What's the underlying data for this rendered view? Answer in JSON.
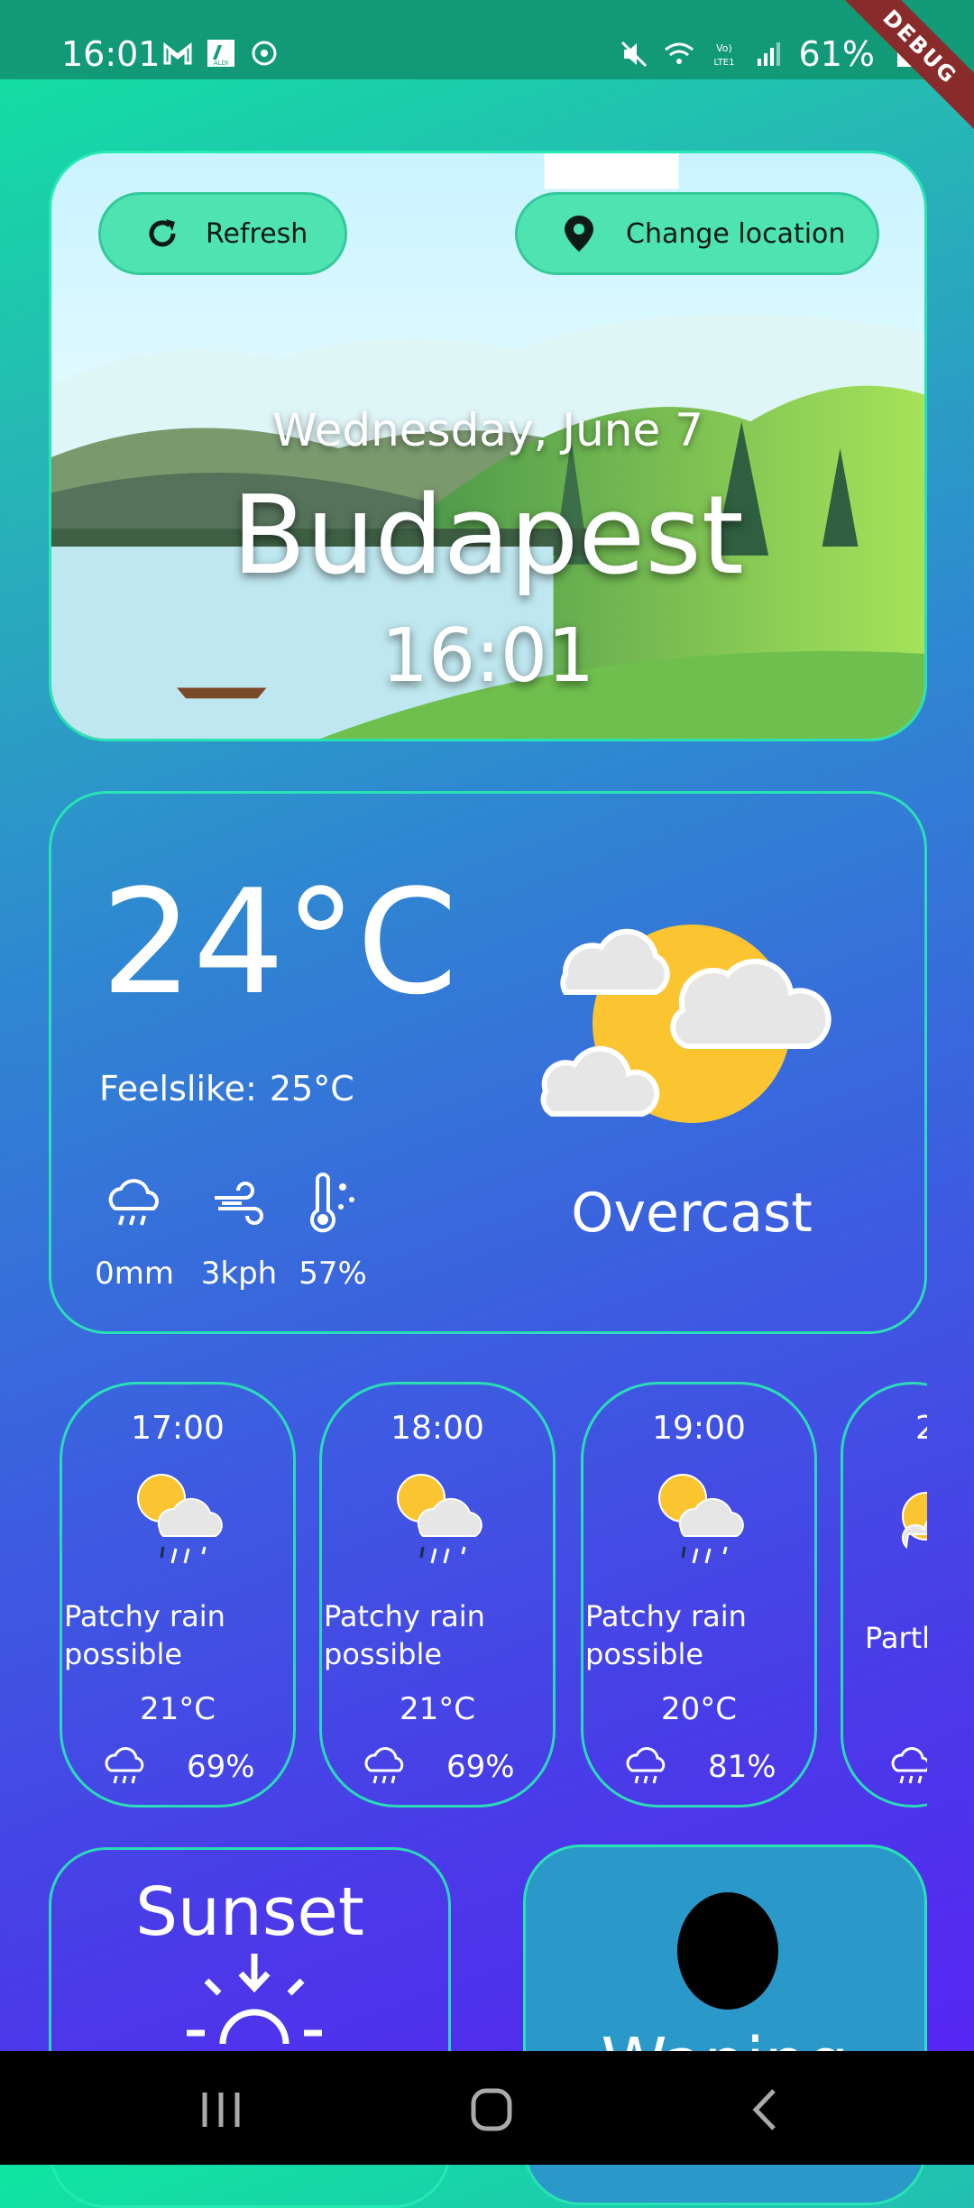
{
  "status_bar": {
    "time": "16:01",
    "battery": "61%",
    "left_icons": [
      "gmail-icon",
      "aldi-icon",
      "sync-icon"
    ],
    "right_icons": [
      "mute-icon",
      "wifi-icon",
      "volte-icon",
      "signal-icon",
      "battery-icon"
    ],
    "debug_banner": "DEBUG"
  },
  "hero": {
    "refresh_label": "Refresh",
    "change_location_label": "Change location",
    "date": "Wednesday, June 7",
    "city": "Budapest",
    "time": "16:01"
  },
  "current": {
    "temperature": "24°C",
    "feels_like_label": "Feelslike:",
    "feels_like_value": "25°C",
    "precipitation": "0mm",
    "wind": "3kph",
    "humidity": "57%",
    "condition": "Overcast"
  },
  "hourly": [
    {
      "time": "17:00",
      "condition": "Patchy rain possible",
      "temp": "21°C",
      "chance": "69%"
    },
    {
      "time": "18:00",
      "condition": "Patchy rain possible",
      "temp": "21°C",
      "chance": "69%"
    },
    {
      "time": "19:00",
      "condition": "Patchy rain possible",
      "temp": "20°C",
      "chance": "81%"
    },
    {
      "time": "2",
      "condition": "Partl",
      "temp": "",
      "chance": ""
    }
  ],
  "sunset": {
    "title": "Sunset"
  },
  "moon": {
    "phase": "Waning"
  },
  "colors": {
    "accent": "#28ebb4",
    "pill": "#4ee3b0",
    "sun": "#fbc531"
  }
}
